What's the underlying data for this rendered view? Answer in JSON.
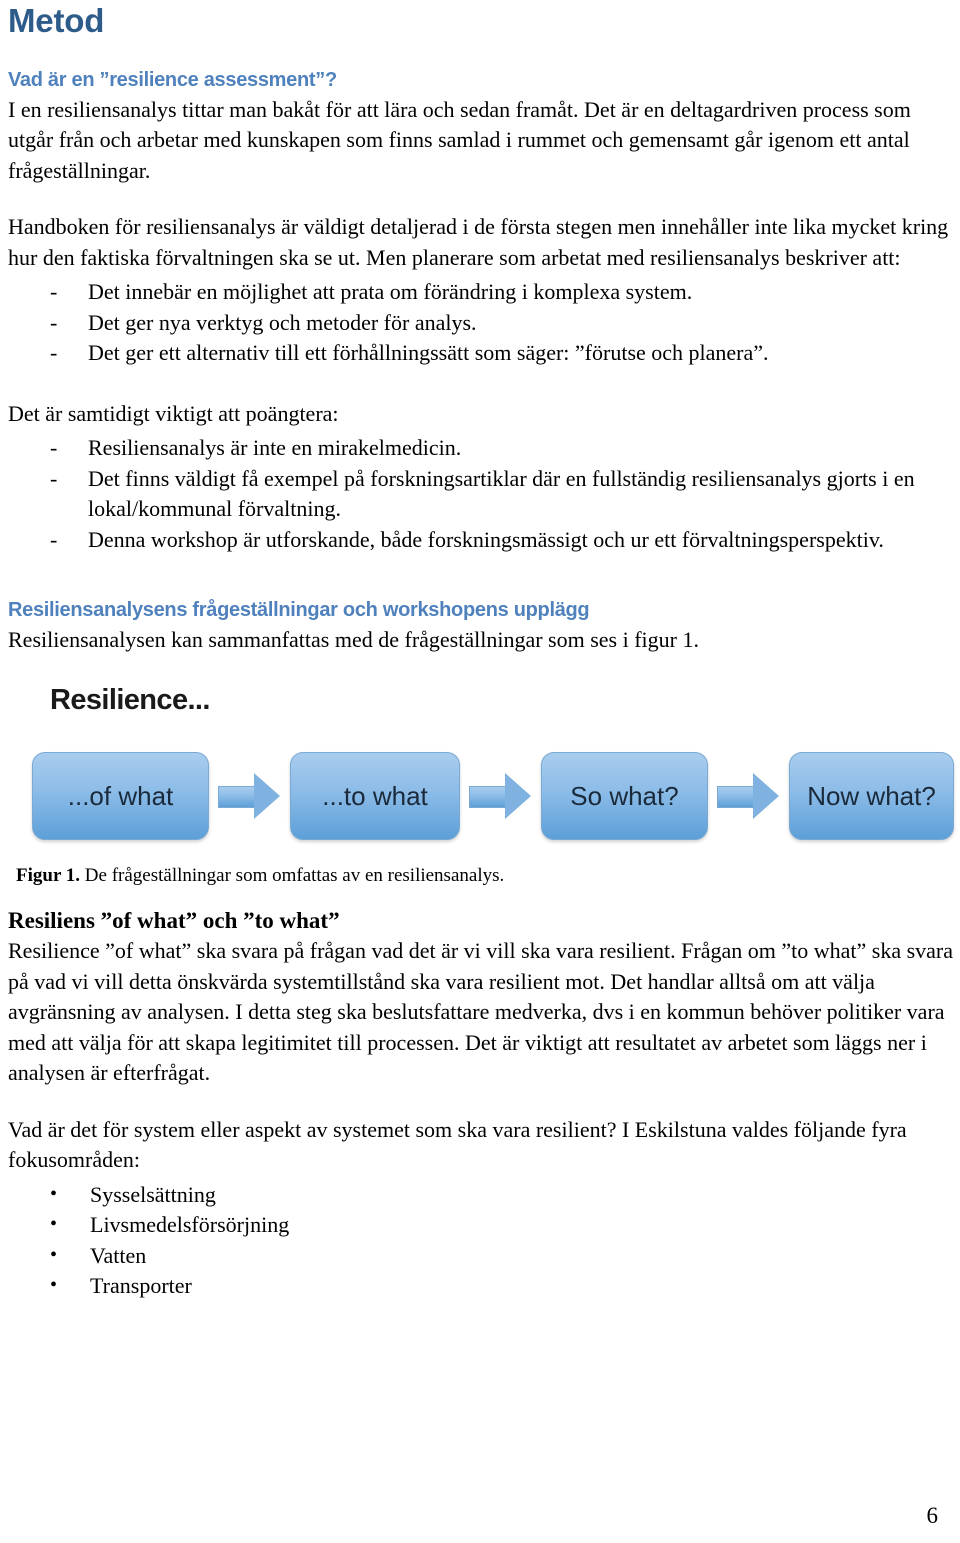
{
  "document": {
    "title": "Metod",
    "page_number": "6"
  },
  "section1": {
    "heading": "Vad är en ”resilience assessment”?",
    "paragraph1": "I en resiliensanalys tittar man bakåt för att lära och sedan framåt. Det är en deltagardriven process som utgår från och arbetar med kunskapen som finns samlad i rummet och gemensamt går igenom ett antal frågeställningar.",
    "paragraph2": "Handboken för resiliensanalys är väldigt detaljerad i de första stegen men innehåller inte lika mycket kring hur den faktiska förvaltningen ska se ut. Men planerare som arbetat med resiliensanalys beskriver att:",
    "list1": [
      {
        "marker": "-",
        "text": "Det innebär en möjlighet att prata om förändring i komplexa system."
      },
      {
        "marker": "-",
        "text": "Det ger nya verktyg och metoder för analys."
      },
      {
        "marker": "-",
        "text": "Det ger ett alternativ till ett förhållningssätt som säger: ”förutse och planera”."
      }
    ],
    "paragraph3": "Det är samtidigt viktigt att poängtera:",
    "list2": [
      {
        "marker": "-",
        "text": "Resiliensanalys är inte en mirakelmedicin."
      },
      {
        "marker": "-",
        "text": "Det finns väldigt få exempel på forskningsartiklar där en fullständig resiliensanalys gjorts i en lokal/kommunal förvaltning."
      },
      {
        "marker": "-",
        "text": "Denna workshop är utforskande, både forskningsmässigt och ur ett förvaltningsperspektiv."
      }
    ]
  },
  "section2": {
    "heading": "Resiliensanalysens frågeställningar och workshopens upplägg",
    "paragraph1": "Resiliensanalysen kan sammanfattas med de frågeställningar som ses i figur 1."
  },
  "figure": {
    "label": "Resilience...",
    "boxes": [
      {
        "text": "...of what"
      },
      {
        "text": "...to what"
      },
      {
        "text": "So what?"
      },
      {
        "text": "Now what?"
      }
    ],
    "caption_prefix": "Figur 1.",
    "caption_text": " De frågeställningar som omfattas av en resiliensanalys.",
    "colors": {
      "box_top": "#a9cdee",
      "box_bottom": "#5d9fd8",
      "box_border": "#7aa9d4",
      "box_text": "#1b2a3a"
    }
  },
  "section3": {
    "heading": "Resiliens ”of what” och ”to what”",
    "paragraph1": "Resilience ”of what” ska svara på frågan vad det är vi vill ska vara resilient. Frågan om ”to what” ska svara på vad vi vill detta önskvärda systemtillstånd ska vara resilient mot. Det handlar alltså om att välja avgränsning av analysen. I detta steg ska beslutsfattare medverka, dvs i en kommun behöver politiker vara med att välja för att skapa legitimitet till processen. Det är viktigt att resultatet av arbetet som läggs ner i analysen är efterfrågat.",
    "paragraph2": "Vad är det för system eller aspekt av systemet som ska vara resilient? I Eskilstuna valdes följande fyra fokusområden:",
    "list": [
      {
        "marker": "•",
        "text": "Sysselsättning"
      },
      {
        "marker": "•",
        "text": "Livsmedelsförsörjning"
      },
      {
        "marker": "•",
        "text": "Vatten"
      },
      {
        "marker": "•",
        "text": "Transporter"
      }
    ]
  },
  "colors": {
    "title_blue": "#2E5C8A",
    "heading_blue": "#4F81BD",
    "body_black": "#000000"
  }
}
